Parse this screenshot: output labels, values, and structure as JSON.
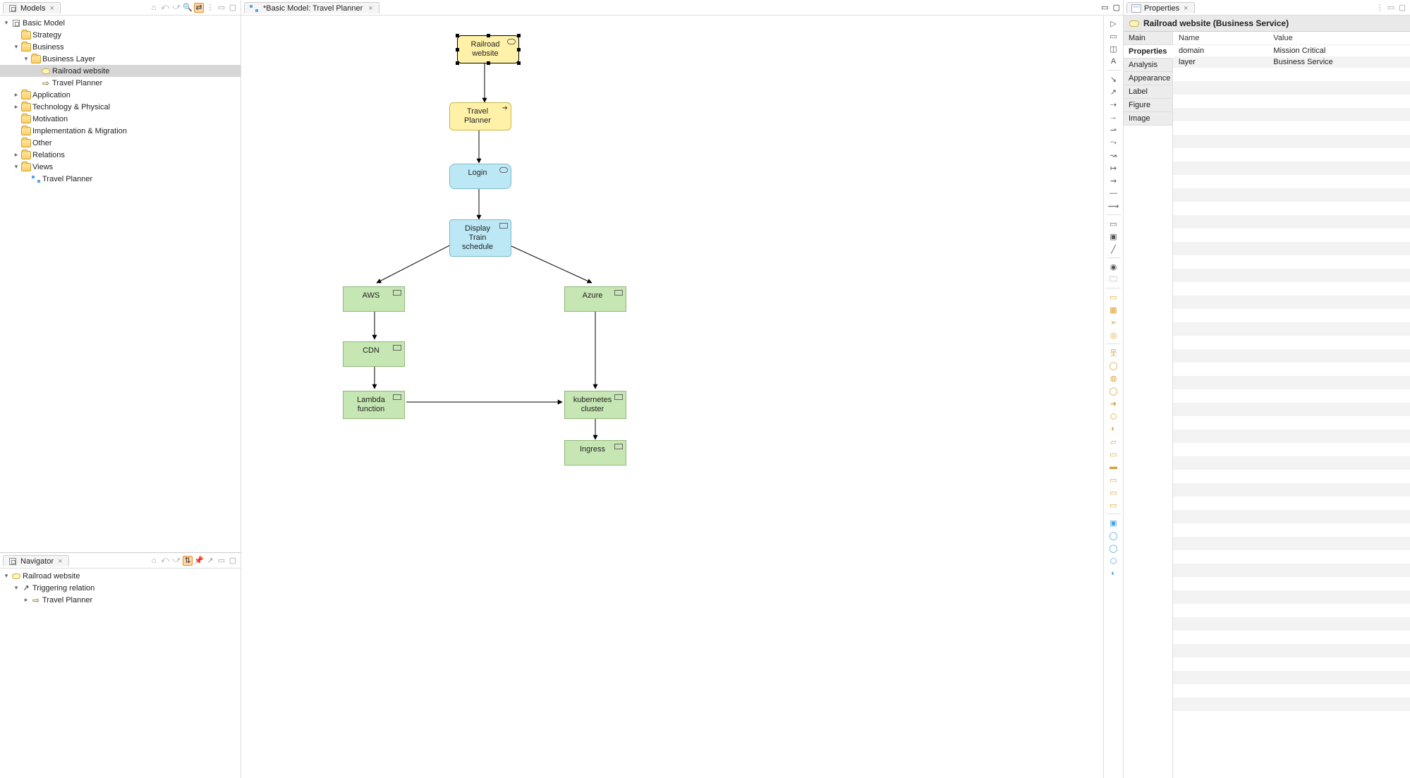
{
  "models_pane": {
    "title": "Models",
    "tree": {
      "root": "Basic Model",
      "strategy": "Strategy",
      "business": "Business",
      "business_layer": "Business Layer",
      "railroad_website": "Railroad website",
      "travel_planner": "Travel Planner",
      "application": "Application",
      "tech_phys": "Technology & Physical",
      "motivation": "Motivation",
      "impl_migration": "Implementation & Migration",
      "other": "Other",
      "relations": "Relations",
      "views": "Views",
      "view_travel": "Travel Planner"
    }
  },
  "navigator_pane": {
    "title": "Navigator",
    "tree": {
      "root": "Railroad website",
      "trigger": "Triggering relation",
      "travel": "Travel Planner"
    }
  },
  "editor": {
    "tab_label": "*Basic Model: Travel Planner",
    "nodes": {
      "railroad": "Railroad website",
      "travel": "Travel Planner",
      "login": "Login",
      "display": "Display Train schedule",
      "aws": "AWS",
      "azure": "Azure",
      "cdn": "CDN",
      "lambda": "Lambda function",
      "k8s": "kubernetes cluster",
      "ingress": "Ingress"
    }
  },
  "properties": {
    "title": "Properties",
    "heading": "Railroad website (Business Service)",
    "tabs": {
      "main": "Main",
      "properties": "Properties",
      "analysis": "Analysis",
      "appearance": "Appearance",
      "label": "Label",
      "figure": "Figure",
      "image": "Image"
    },
    "cols": {
      "name": "Name",
      "value": "Value"
    },
    "rows": [
      {
        "name": "domain",
        "value": "Mission Critical"
      },
      {
        "name": "layer",
        "value": "Business Service"
      }
    ]
  }
}
